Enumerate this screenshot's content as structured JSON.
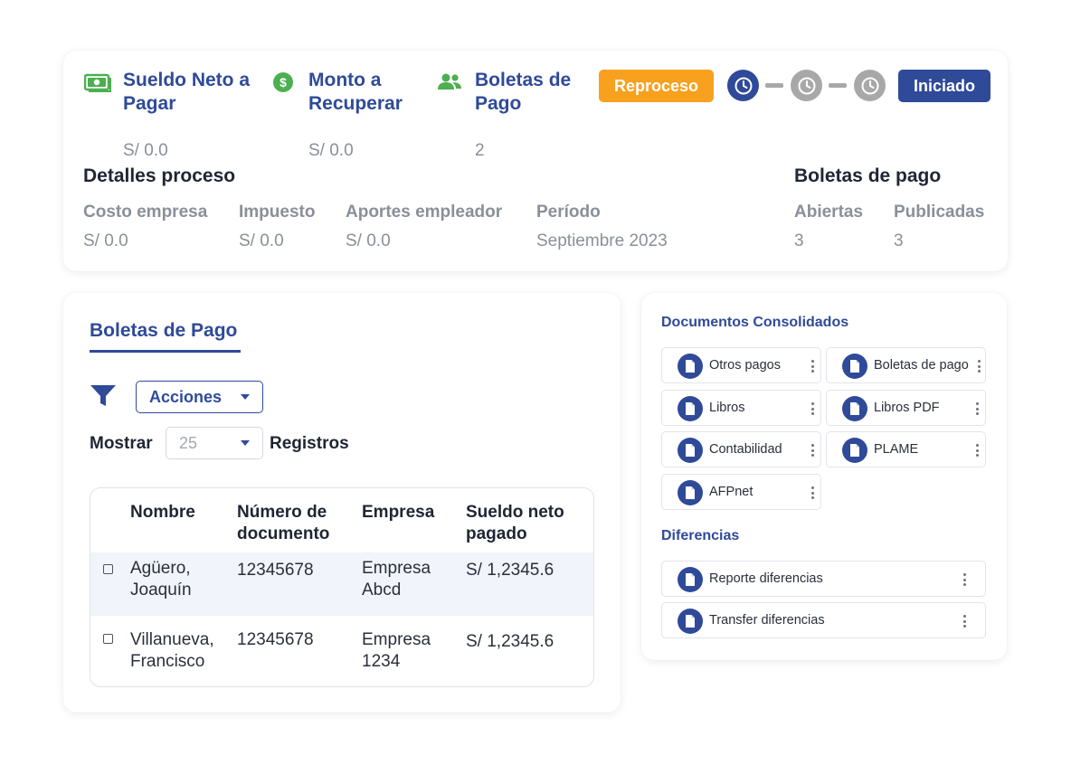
{
  "summary": {
    "metrics": [
      {
        "title": "Sueldo Neto a Pagar",
        "value": "S/ 0.0",
        "icon": "money-bill-icon",
        "icon_color": "#4caf50"
      },
      {
        "title": "Monto a Recuperar",
        "value": "S/ 0.0",
        "icon": "dollar-circle-icon",
        "icon_color": "#4caf50"
      },
      {
        "title": "Boletas de Pago",
        "value": "2",
        "icon": "users-icon",
        "icon_color": "#4caf50"
      }
    ],
    "reproceso_label": "Reproceso",
    "status_label": "Iniciado",
    "steps": [
      "active",
      "inactive",
      "inactive"
    ],
    "details": {
      "title": "Detalles proceso",
      "items": [
        {
          "label": "Costo empresa",
          "value": "S/ 0.0"
        },
        {
          "label": "Impuesto",
          "value": "S/ 0.0"
        },
        {
          "label": "Aportes empleador",
          "value": "S/ 0.0"
        },
        {
          "label": "Período",
          "value": "Septiembre 2023"
        }
      ]
    },
    "boletas": {
      "title": "Boletas de pago",
      "items": [
        {
          "label": "Abiertas",
          "value": "3"
        },
        {
          "label": "Publicadas",
          "value": "3"
        }
      ]
    }
  },
  "boletas_panel": {
    "tab": "Boletas de Pago",
    "acciones_label": "Acciones",
    "mostrar_label": "Mostrar",
    "page_size": "25",
    "registros_label": "Registros",
    "table": {
      "headers": [
        "Nombre",
        "Número de documento",
        "Empresa",
        "Sueldo neto pagado"
      ],
      "rows": [
        {
          "nombre": "Agüero, Joaquín",
          "documento": "12345678",
          "empresa": "Empresa Abcd",
          "sueldo": "S/ 1,2345.6"
        },
        {
          "nombre": "Villanueva, Francisco",
          "documento": "12345678",
          "empresa": "Empresa 1234",
          "sueldo": "S/ 1,2345.6"
        }
      ]
    }
  },
  "docs_panel": {
    "consolidados_title": "Documentos Consolidados",
    "consolidados": [
      "Otros pagos",
      "Boletas de pago",
      "Libros",
      "Libros PDF",
      "Contabilidad",
      "PLAME",
      "AFPnet"
    ],
    "diferencias_title": "Diferencias",
    "diferencias": [
      "Reporte diferencias",
      "Transfer diferencias"
    ]
  },
  "colors": {
    "primary": "#2f4a99",
    "accent_orange": "#f7a11e",
    "success_green": "#4caf50"
  }
}
